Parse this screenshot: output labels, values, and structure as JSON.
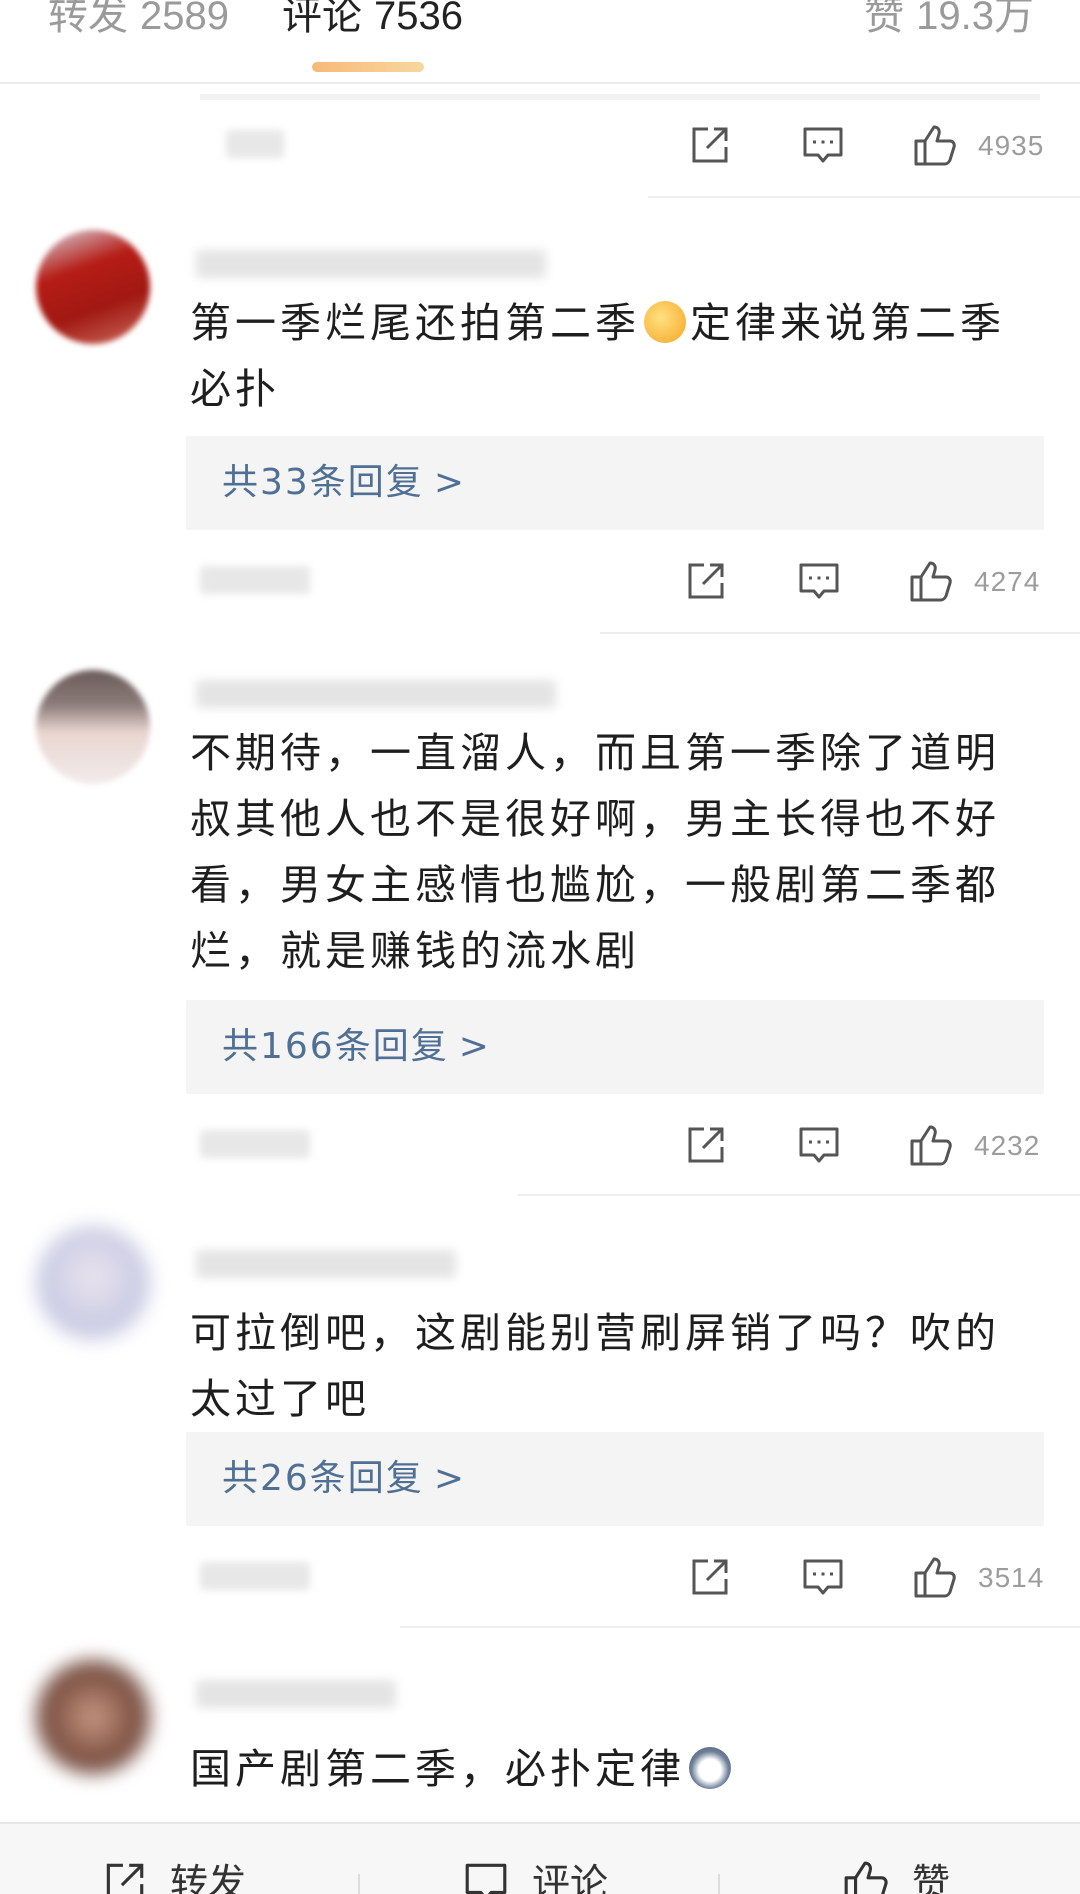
{
  "tabs": {
    "repost": {
      "label": "转发",
      "count": "2589"
    },
    "comment": {
      "label": "评论",
      "count": "7536"
    },
    "like": {
      "label": "赞",
      "count": "19.3万"
    }
  },
  "action_rows": [
    {
      "like_count": "4935"
    },
    {
      "like_count": "4274"
    },
    {
      "like_count": "4232"
    },
    {
      "like_count": "3514"
    }
  ],
  "comments": [
    {
      "text_before_emoji": "第一季烂尾还拍第二季",
      "emoji": "yum-face-emoji",
      "text_after_emoji": "定律来说第二季必扑",
      "reply_label": "共33条回复"
    },
    {
      "text": "不期待，一直溜人，而且第一季除了道明叔其他人也不是很好啊，男主长得也不好看，男女主感情也尴尬，一般剧第二季都烂，就是赚钱的流水剧",
      "reply_label": "共166条回复"
    },
    {
      "text": "可拉倒吧，这剧能别营刷屏销了吗？吹的太过了吧",
      "reply_label": "共26条回复"
    },
    {
      "text_before_emoji": "国产剧第二季，必扑定律",
      "emoji": "husky-emoji"
    }
  ],
  "reply_chevron": ">",
  "icons": {
    "share": "share-icon",
    "comment": "comment-icon",
    "like": "thumbs-up-icon"
  },
  "bottom_bar": {
    "repost_label": "转发",
    "comment_label": "评论",
    "like_label": "赞"
  },
  "colors": {
    "accent": "#f7b97a",
    "reply_link": "#4f6f94",
    "muted": "#9c9c9c"
  }
}
